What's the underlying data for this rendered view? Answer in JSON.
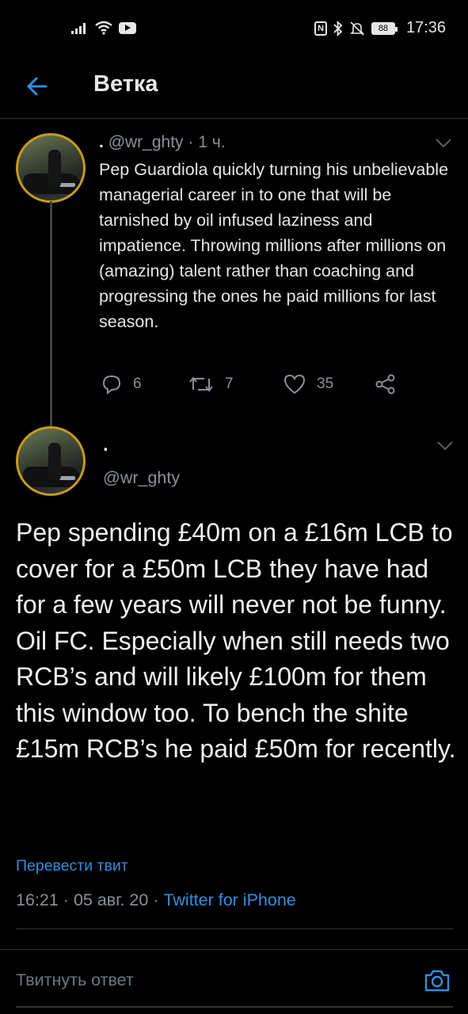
{
  "status_bar": {
    "battery_level": "88",
    "time": "17:36"
  },
  "header": {
    "title": "Ветка"
  },
  "reply_tweet": {
    "display_name": ".",
    "handle": "@wr_ghty",
    "separator": "·",
    "age": "1 ч.",
    "text": "Pep Guardiola quickly turning his unbelievable managerial career in to one that will be tarnished by oil infused laziness and impatience. Throwing millions after millions on (amazing) talent rather than coaching and progressing the ones he paid millions for last season.",
    "replies": "6",
    "retweets": "7",
    "likes": "35"
  },
  "main_tweet": {
    "display_name": ".",
    "handle": "@wr_ghty",
    "text": "Pep spending £40m on a £16m LCB to cover for a £50m LCB they have had for a few years will never not be funny. Oil FC. Especially when still needs two RCB’s and will likely £100m for them this window too. To bench the shite £15m RCB’s he paid £50m for recently.",
    "translate_label": "Перевести твит",
    "time": "16:21",
    "date": "05 авг. 20",
    "separator": "·",
    "source": "Twitter for iPhone"
  },
  "reply_bar": {
    "placeholder": "Твитнуть ответ"
  },
  "colors": {
    "background": "#000000",
    "accent": "#2f8fe0",
    "secondary_text": "#8b9096",
    "avatar_ring": "#c79a1e"
  },
  "icons": [
    "signal-icon",
    "wifi-icon",
    "youtube-icon",
    "nfc-icon",
    "bluetooth-icon",
    "mute-icon",
    "battery-icon",
    "back-arrow-icon",
    "chevron-down-icon",
    "reply-icon",
    "retweet-icon",
    "like-icon",
    "share-icon",
    "camera-icon"
  ]
}
